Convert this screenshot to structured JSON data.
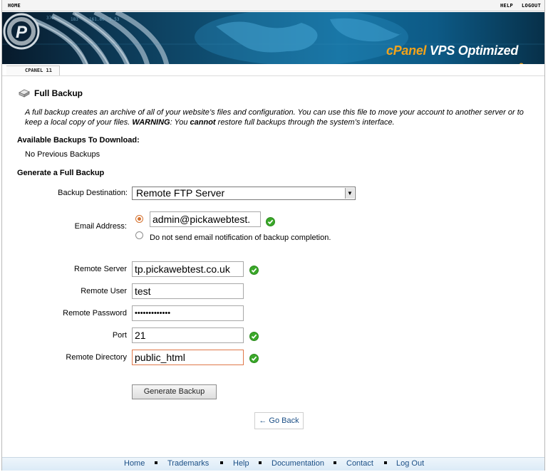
{
  "topbar": {
    "home": "HOME",
    "help": "HELP",
    "logout": "LOGOUT"
  },
  "banner": {
    "logo_cpanel": "cPanel",
    "logo_rest": " VPS Optimized",
    "logo_version": "3",
    "ticker": [
      "373",
      "183",
      "161.60",
      "1.53"
    ]
  },
  "breadcrumb": {
    "label": "CPANEL 11"
  },
  "page": {
    "title": "Full Backup",
    "icon": "backup-drive-icon",
    "intro_text": "A full backup creates an archive of all of your website’s files and configuration. You can use this file to move your account to another server or to keep a local copy of your files.",
    "warning_label": "WARNING",
    "warning_prefix": ": You ",
    "warning_emph": "cannot",
    "warning_suffix": " restore full backups through the system’s interface."
  },
  "available": {
    "heading": "Available Backups To Download:",
    "empty_text": "No Previous Backups"
  },
  "generate": {
    "heading": "Generate a Full Backup",
    "destination_label": "Backup Destination:",
    "destination_value": "Remote FTP Server",
    "email_label": "Email Address:",
    "email_value": "admin@pickawebtest.",
    "no_email_label": "Do not send email notification of backup completion.",
    "server_label": "Remote Server",
    "server_value": "tp.pickawebtest.co.uk",
    "user_label": "Remote User",
    "user_value": "test",
    "password_label": "Remote Password",
    "password_value": "•••••••••••••",
    "port_label": "Port",
    "port_value": "21",
    "directory_label": "Remote Directory",
    "directory_value": "public_html",
    "submit_label": "Generate Backup"
  },
  "go_back": "← Go Back",
  "footer": {
    "links": [
      "Home",
      "Trademarks",
      "Help",
      "Documentation",
      "Contact",
      "Log Out"
    ]
  },
  "colors": {
    "link": "#1b4f86",
    "check": "#3aa829",
    "radio_selected": "#d5722f",
    "logo_accent": "#f2a31b"
  }
}
